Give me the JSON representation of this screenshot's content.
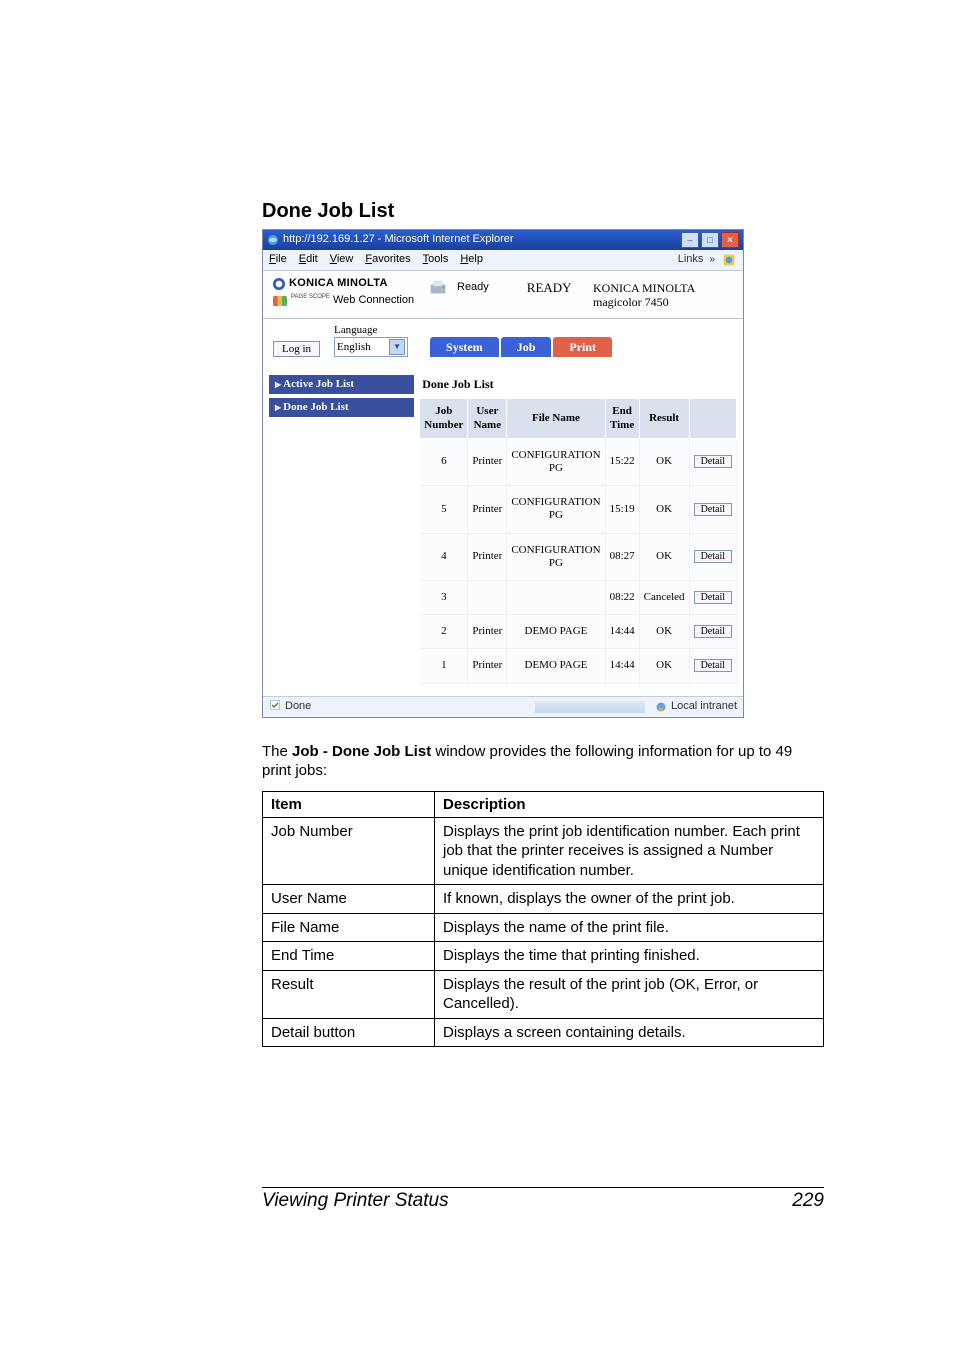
{
  "section_title": "Done Job List",
  "browser": {
    "title": "http://192.169.1.27 - Microsoft Internet Explorer",
    "menu": [
      "File",
      "Edit",
      "View",
      "Favorites",
      "Tools",
      "Help"
    ],
    "links_label": "Links",
    "statusbar_left": "Done",
    "statusbar_right": "Local intranet"
  },
  "header": {
    "brand_line1": "KONICA MINOLTA",
    "brand_line2": "Web Connection",
    "ps_label": "PAGE SCOPE",
    "status_label": "Ready",
    "status_text": "READY",
    "model_line1": "KONICA MINOLTA",
    "model_line2": "magicolor 7450"
  },
  "controls": {
    "login": "Log in",
    "lang_label": "Language",
    "lang_value": "English"
  },
  "tabs": {
    "system": "System",
    "job": "Job",
    "print": "Print"
  },
  "sidebar": {
    "items": [
      {
        "label": "Active Job List"
      },
      {
        "label": "Done Job List"
      }
    ]
  },
  "main": {
    "heading": "Done Job List",
    "columns": {
      "job_number": "Job Number",
      "user_name": "User Name",
      "file_name": "File Name",
      "end_time": "End Time",
      "result": "Result"
    },
    "detail_label": "Detail",
    "rows": [
      {
        "job_number": "6",
        "user_name": "Printer",
        "file_name": "CONFIGURATION PG",
        "end_time": "15:22",
        "result": "OK"
      },
      {
        "job_number": "5",
        "user_name": "Printer",
        "file_name": "CONFIGURATION PG",
        "end_time": "15:19",
        "result": "OK"
      },
      {
        "job_number": "4",
        "user_name": "Printer",
        "file_name": "CONFIGURATION PG",
        "end_time": "08:27",
        "result": "OK"
      },
      {
        "job_number": "3",
        "user_name": "",
        "file_name": "",
        "end_time": "08:22",
        "result": "Canceled"
      },
      {
        "job_number": "2",
        "user_name": "Printer",
        "file_name": "DEMO PAGE",
        "end_time": "14:44",
        "result": "OK"
      },
      {
        "job_number": "1",
        "user_name": "Printer",
        "file_name": "DEMO PAGE",
        "end_time": "14:44",
        "result": "OK"
      }
    ]
  },
  "caption": {
    "prefix": "The ",
    "bold": "Job - Done Job List",
    "suffix": " window provides the following information for up to 49 print jobs:"
  },
  "desc_table": {
    "headers": {
      "item": "Item",
      "description": "Description"
    },
    "rows": [
      {
        "item": "Job Number",
        "description": "Displays the print job identification number. Each print job that the printer receives is assigned a Number unique identification number."
      },
      {
        "item": "User Name",
        "description": "If known, displays the owner of the print job."
      },
      {
        "item": "File Name",
        "description": "Displays the name of the print file."
      },
      {
        "item": "End Time",
        "description": "Displays the time that printing finished."
      },
      {
        "item": "Result",
        "description": "Displays the result of the print job (OK, Error, or Cancelled)."
      },
      {
        "item": "Detail button",
        "description": "Displays a screen containing details."
      }
    ]
  },
  "footer": {
    "title": "Viewing Printer Status",
    "page": "229"
  }
}
